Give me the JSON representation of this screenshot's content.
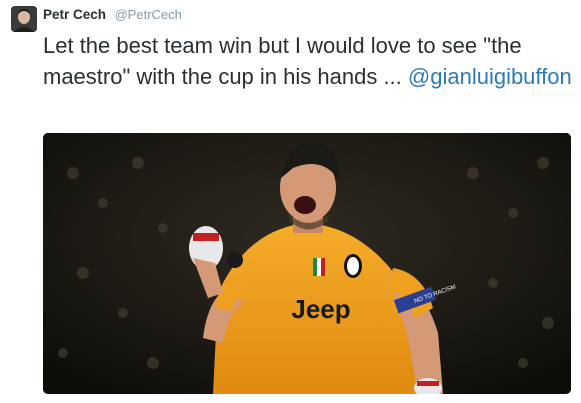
{
  "tweet": {
    "author": {
      "display_name": "Petr Cech",
      "handle": "@PetrCech"
    },
    "text_before_mention": "Let the best team win but I would love to see \"the maestro\" with the cup in his hands ... ",
    "mention": "@gianluigibuffon",
    "media": {
      "kit_sponsor": "Jeep",
      "armband_text": "NO TO RACISM",
      "colors": {
        "jersey": "#f0a020",
        "sleeve_band": "#2a3f8f",
        "background": "#1a1814"
      }
    }
  },
  "colors": {
    "name": "#292f33",
    "handle": "#8899a6",
    "link": "#2b7bb9"
  }
}
